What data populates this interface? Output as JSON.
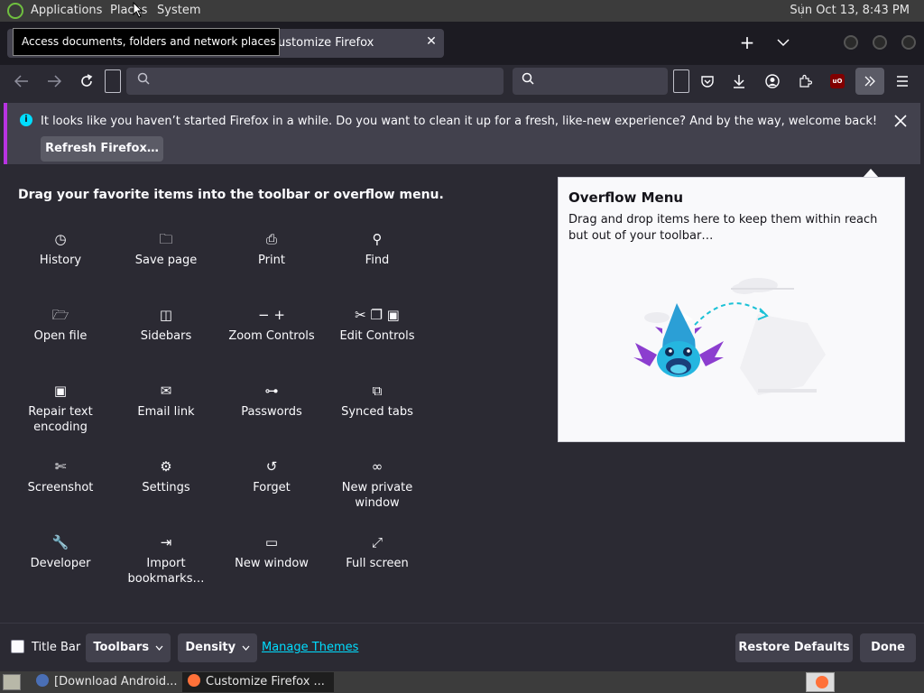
{
  "topbar": {
    "menus": [
      "Applications",
      "Places",
      "System"
    ],
    "clock": "Sun Oct 13,  8:43 PM"
  },
  "tab": {
    "title": "ustomize Firefox",
    "close_glyph": "✕"
  },
  "tooltip": "Access documents, folders and network places",
  "notification": {
    "text": "It looks like you haven’t started Firefox in a while. Do you want to clean it up for a fresh, like-new experience? And by the way, welcome back!",
    "button": "Refresh Firefox…"
  },
  "palette": {
    "heading": "Drag your favorite items into the toolbar or overflow menu.",
    "items": [
      {
        "label": "History",
        "icon": "clock-icon",
        "glyph": "◷"
      },
      {
        "label": "Save page",
        "icon": "save-page-icon",
        "glyph": "🗀"
      },
      {
        "label": "Print",
        "icon": "print-icon",
        "glyph": "⎙"
      },
      {
        "label": "Find",
        "icon": "find-icon",
        "glyph": "⚲"
      },
      {
        "label": "Open file",
        "icon": "open-file-icon",
        "glyph": "🗁"
      },
      {
        "label": "Sidebars",
        "icon": "sidebars-icon",
        "glyph": "◫"
      },
      {
        "label": "Zoom Controls",
        "icon": "zoom-icon",
        "glyph": "− +"
      },
      {
        "label": "Edit Controls",
        "icon": "edit-icon",
        "glyph": "✂ ❐ ▣"
      },
      {
        "label": "Repair text encoding",
        "icon": "repair-encoding-icon",
        "glyph": "▣"
      },
      {
        "label": "Email link",
        "icon": "email-icon",
        "glyph": "✉"
      },
      {
        "label": "Passwords",
        "icon": "key-icon",
        "glyph": "⊶"
      },
      {
        "label": "Synced tabs",
        "icon": "synced-tabs-icon",
        "glyph": "⧉"
      },
      {
        "label": "Screenshot",
        "icon": "screenshot-icon",
        "glyph": "✄"
      },
      {
        "label": "Settings",
        "icon": "gear-icon",
        "glyph": "⚙"
      },
      {
        "label": "Forget",
        "icon": "forget-icon",
        "glyph": "↺"
      },
      {
        "label": "New private window",
        "icon": "private-window-icon",
        "glyph": "∞"
      },
      {
        "label": "Developer",
        "icon": "wrench-icon",
        "glyph": "🔧"
      },
      {
        "label": "Import bookmarks…",
        "icon": "import-icon",
        "glyph": "⇥"
      },
      {
        "label": "New window",
        "icon": "new-window-icon",
        "glyph": "▭"
      },
      {
        "label": "Full screen",
        "icon": "fullscreen-icon",
        "glyph": "⤢"
      }
    ]
  },
  "overflow_panel": {
    "title": "Overflow Menu",
    "description": "Drag and drop items here to keep them within reach but out of your toolbar…"
  },
  "bottom": {
    "title_bar_label": "Title Bar",
    "toolbars": "Toolbars",
    "density": "Density",
    "manage_themes": "Manage Themes",
    "restore_defaults": "Restore Defaults",
    "done": "Done"
  },
  "taskbar": {
    "tasks": [
      "[Download Android...",
      "Customize Firefox ..."
    ]
  },
  "colors": {
    "accent": "#00ddff",
    "notification_stripe": "#b833e1",
    "ublock_red": "#800000"
  }
}
